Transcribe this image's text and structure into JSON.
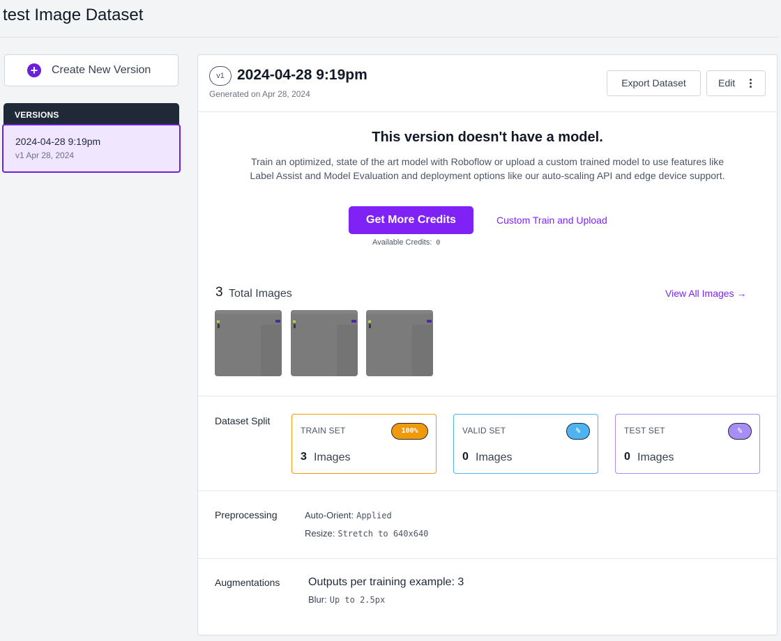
{
  "page": {
    "title": "test Image Dataset"
  },
  "sidebar": {
    "create_label": "Create New Version",
    "versions_heading": "VERSIONS",
    "versions": [
      {
        "name": "2024-04-28 9:19pm",
        "sub": "v1 Apr 28, 2024"
      }
    ]
  },
  "version": {
    "badge": "v1",
    "title": "2024-04-28 9:19pm",
    "generated": "Generated on Apr 28, 2024",
    "export_label": "Export Dataset",
    "edit_label": "Edit"
  },
  "model": {
    "title": "This version doesn't have a model.",
    "description": "Train an optimized, state of the art model with Roboflow or upload a custom trained model to use features like Label Assist and Model Evaluation and deployment options like our auto-scaling API and edge device support.",
    "credits_button": "Get More Credits",
    "custom_link": "Custom Train and Upload",
    "available_label": "Available Credits:",
    "available_value": "0"
  },
  "images": {
    "count": "3",
    "label": "Total Images",
    "view_all": "View All Images →",
    "thumbnails": 3
  },
  "split": {
    "label": "Dataset Split",
    "sets": [
      {
        "name": "TRAIN SET",
        "badge": "100%",
        "count": "3",
        "unit": "Images",
        "color": "#f09a0a"
      },
      {
        "name": "VALID SET",
        "badge": "%",
        "count": "0",
        "unit": "Images",
        "color": "#4eb3f0"
      },
      {
        "name": "TEST SET",
        "badge": "%",
        "count": "0",
        "unit": "Images",
        "color": "#a68ef5"
      }
    ]
  },
  "preprocessing": {
    "label": "Preprocessing",
    "items": [
      {
        "key": "Auto-Orient:",
        "value": "Applied"
      },
      {
        "key": "Resize:",
        "value": "Stretch to 640x640"
      }
    ]
  },
  "augmentations": {
    "label": "Augmentations",
    "outputs": "Outputs per training example: 3",
    "items": [
      {
        "key": "Blur:",
        "value": "Up to 2.5px"
      }
    ]
  }
}
